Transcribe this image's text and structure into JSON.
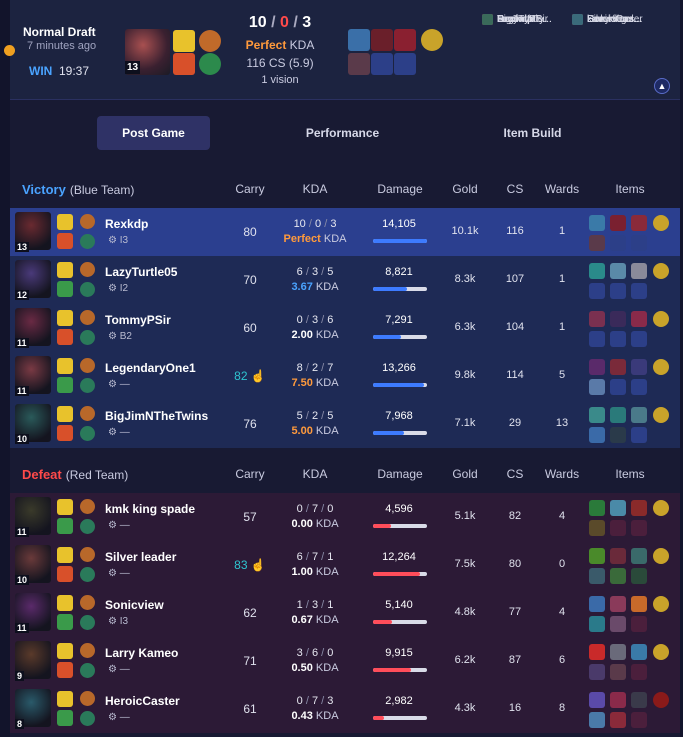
{
  "header": {
    "queue": "Normal Draft",
    "ago": "7 minutes ago",
    "result": "WIN",
    "duration": "19:37",
    "level": "13",
    "kills": "10",
    "deaths": "0",
    "assists": "3",
    "kda_label": "Perfect",
    "kda_suffix": "KDA",
    "cs": "116 CS (5.9)",
    "vision": "1 vision",
    "sep": "/"
  },
  "participants": [
    {
      "name": "Rexkdp"
    },
    {
      "name": "LazyTurtle..."
    },
    {
      "name": "TommyPSir"
    },
    {
      "name": "Legendary..."
    },
    {
      "name": "BigJimNT..."
    },
    {
      "name": "kmk king s..."
    },
    {
      "name": "Silver leader"
    },
    {
      "name": "Sonicview"
    },
    {
      "name": "Larry Kam..."
    },
    {
      "name": "HeroicCas..."
    }
  ],
  "tabs": [
    "Post Game",
    "Performance",
    "Item Build"
  ],
  "columns": {
    "carry": "Carry",
    "kda": "KDA",
    "damage": "Damage",
    "gold": "Gold",
    "cs": "CS",
    "wards": "Wards",
    "items": "Items"
  },
  "blue_team": {
    "result": "Victory",
    "label": "(Blue Team)"
  },
  "red_team": {
    "result": "Defeat",
    "label": "(Red Team)"
  },
  "blue_rows": [
    {
      "level": "13",
      "name": "Rexkdp",
      "rank": "I3",
      "carry": "80",
      "k": "10",
      "d": "0",
      "a": "3",
      "kda": "Perfect",
      "dmg": "14,105",
      "dmg_frac": 1.0,
      "gold": "10.1k",
      "cs": "116",
      "wards": "1"
    },
    {
      "level": "12",
      "name": "LazyTurtle05",
      "rank": "I2",
      "carry": "70",
      "k": "6",
      "d": "3",
      "a": "5",
      "kda": "3.67",
      "dmg": "8,821",
      "dmg_frac": 0.63,
      "gold": "8.3k",
      "cs": "107",
      "wards": "1"
    },
    {
      "level": "11",
      "name": "TommyPSir",
      "rank": "B2",
      "carry": "60",
      "k": "0",
      "d": "3",
      "a": "6",
      "kda": "2.00",
      "dmg": "7,291",
      "dmg_frac": 0.52,
      "gold": "6.3k",
      "cs": "104",
      "wards": "1"
    },
    {
      "level": "11",
      "name": "LegendaryOne1",
      "rank": "—",
      "carry": "82",
      "k": "8",
      "d": "2",
      "a": "7",
      "kda": "7.50",
      "dmg": "13,266",
      "dmg_frac": 0.94,
      "gold": "9.8k",
      "cs": "114",
      "wards": "5"
    },
    {
      "level": "10",
      "name": "BigJimNTheTwins",
      "rank": "—",
      "carry": "76",
      "k": "5",
      "d": "2",
      "a": "5",
      "kda": "5.00",
      "dmg": "7,968",
      "dmg_frac": 0.57,
      "gold": "7.1k",
      "cs": "29",
      "wards": "13"
    }
  ],
  "red_rows": [
    {
      "level": "11",
      "name": "kmk king spade",
      "rank": "—",
      "carry": "57",
      "k": "0",
      "d": "7",
      "a": "0",
      "kda": "0.00",
      "dmg": "4,596",
      "dmg_frac": 0.33,
      "gold": "5.1k",
      "cs": "82",
      "wards": "4"
    },
    {
      "level": "10",
      "name": "Silver leader",
      "rank": "—",
      "carry": "83",
      "k": "6",
      "d": "7",
      "a": "1",
      "kda": "1.00",
      "dmg": "12,264",
      "dmg_frac": 0.87,
      "gold": "7.5k",
      "cs": "80",
      "wards": "0"
    },
    {
      "level": "11",
      "name": "Sonicview",
      "rank": "I3",
      "carry": "62",
      "k": "1",
      "d": "3",
      "a": "1",
      "kda": "0.67",
      "dmg": "5,140",
      "dmg_frac": 0.36,
      "gold": "4.8k",
      "cs": "77",
      "wards": "4"
    },
    {
      "level": "9",
      "name": "Larry Kameo",
      "rank": "—",
      "carry": "71",
      "k": "3",
      "d": "6",
      "a": "0",
      "kda": "0.50",
      "dmg": "9,915",
      "dmg_frac": 0.7,
      "gold": "6.2k",
      "cs": "87",
      "wards": "6"
    },
    {
      "level": "8",
      "name": "HeroicCaster",
      "rank": "—",
      "carry": "61",
      "k": "0",
      "d": "7",
      "a": "3",
      "kda": "0.43",
      "dmg": "2,982",
      "dmg_frac": 0.21,
      "gold": "4.3k",
      "cs": "16",
      "wards": "8"
    }
  ],
  "colors": {
    "win": "#4aa3ff",
    "loss": "#ff4a4a",
    "perfect": "#ff9a3c",
    "carry_mvp": "#2ec4d0",
    "blue_bar": "#3d7bff",
    "red_bar": "#ff4d5a"
  }
}
